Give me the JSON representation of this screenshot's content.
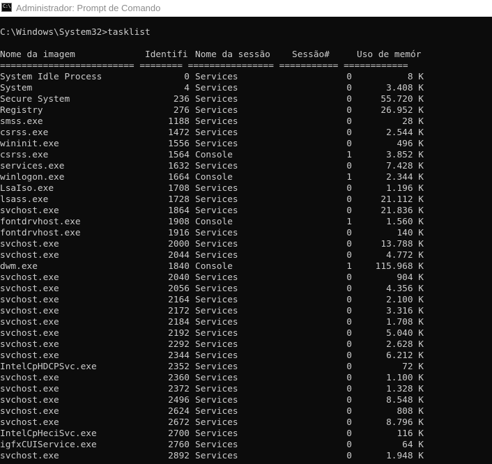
{
  "window": {
    "title": "Administrador: Prompt de Comando",
    "icon_glyph": "C:\\",
    "colors": {
      "console_bg": "#0c0c0c",
      "console_fg": "#cccccc",
      "titlebar_bg": "#ffffff",
      "title_fg": "#8c8c8c"
    }
  },
  "console": {
    "prompt_line": "C:\\Windows\\System32>tasklist",
    "headers": {
      "image": "Nome da imagem",
      "pid": "Identifi",
      "session_name": "Nome da sessão",
      "session_num": "Sessão#",
      "mem": "Uso de memór"
    },
    "separator": "========================= ======== ================ =========== ============",
    "rows": [
      {
        "image": "System Idle Process",
        "pid": "0",
        "session_name": "Services",
        "session_num": "0",
        "mem": "8 K"
      },
      {
        "image": "System",
        "pid": "4",
        "session_name": "Services",
        "session_num": "0",
        "mem": "3.408 K"
      },
      {
        "image": "Secure System",
        "pid": "236",
        "session_name": "Services",
        "session_num": "0",
        "mem": "55.720 K"
      },
      {
        "image": "Registry",
        "pid": "276",
        "session_name": "Services",
        "session_num": "0",
        "mem": "26.952 K"
      },
      {
        "image": "smss.exe",
        "pid": "1188",
        "session_name": "Services",
        "session_num": "0",
        "mem": "28 K"
      },
      {
        "image": "csrss.exe",
        "pid": "1472",
        "session_name": "Services",
        "session_num": "0",
        "mem": "2.544 K"
      },
      {
        "image": "wininit.exe",
        "pid": "1556",
        "session_name": "Services",
        "session_num": "0",
        "mem": "496 K"
      },
      {
        "image": "csrss.exe",
        "pid": "1564",
        "session_name": "Console",
        "session_num": "1",
        "mem": "3.852 K"
      },
      {
        "image": "services.exe",
        "pid": "1632",
        "session_name": "Services",
        "session_num": "0",
        "mem": "7.428 K"
      },
      {
        "image": "winlogon.exe",
        "pid": "1664",
        "session_name": "Console",
        "session_num": "1",
        "mem": "2.344 K"
      },
      {
        "image": "LsaIso.exe",
        "pid": "1708",
        "session_name": "Services",
        "session_num": "0",
        "mem": "1.196 K"
      },
      {
        "image": "lsass.exe",
        "pid": "1728",
        "session_name": "Services",
        "session_num": "0",
        "mem": "21.112 K"
      },
      {
        "image": "svchost.exe",
        "pid": "1864",
        "session_name": "Services",
        "session_num": "0",
        "mem": "21.836 K"
      },
      {
        "image": "fontdrvhost.exe",
        "pid": "1908",
        "session_name": "Console",
        "session_num": "1",
        "mem": "1.560 K"
      },
      {
        "image": "fontdrvhost.exe",
        "pid": "1916",
        "session_name": "Services",
        "session_num": "0",
        "mem": "140 K"
      },
      {
        "image": "svchost.exe",
        "pid": "2000",
        "session_name": "Services",
        "session_num": "0",
        "mem": "13.788 K"
      },
      {
        "image": "svchost.exe",
        "pid": "2044",
        "session_name": "Services",
        "session_num": "0",
        "mem": "4.772 K"
      },
      {
        "image": "dwm.exe",
        "pid": "1840",
        "session_name": "Console",
        "session_num": "1",
        "mem": "115.968 K"
      },
      {
        "image": "svchost.exe",
        "pid": "2040",
        "session_name": "Services",
        "session_num": "0",
        "mem": "904 K"
      },
      {
        "image": "svchost.exe",
        "pid": "2056",
        "session_name": "Services",
        "session_num": "0",
        "mem": "4.356 K"
      },
      {
        "image": "svchost.exe",
        "pid": "2164",
        "session_name": "Services",
        "session_num": "0",
        "mem": "2.100 K"
      },
      {
        "image": "svchost.exe",
        "pid": "2172",
        "session_name": "Services",
        "session_num": "0",
        "mem": "3.316 K"
      },
      {
        "image": "svchost.exe",
        "pid": "2184",
        "session_name": "Services",
        "session_num": "0",
        "mem": "1.708 K"
      },
      {
        "image": "svchost.exe",
        "pid": "2192",
        "session_name": "Services",
        "session_num": "0",
        "mem": "5.040 K"
      },
      {
        "image": "svchost.exe",
        "pid": "2292",
        "session_name": "Services",
        "session_num": "0",
        "mem": "2.628 K"
      },
      {
        "image": "svchost.exe",
        "pid": "2344",
        "session_name": "Services",
        "session_num": "0",
        "mem": "6.212 K"
      },
      {
        "image": "IntelCpHDCPSvc.exe",
        "pid": "2352",
        "session_name": "Services",
        "session_num": "0",
        "mem": "72 K"
      },
      {
        "image": "svchost.exe",
        "pid": "2360",
        "session_name": "Services",
        "session_num": "0",
        "mem": "1.100 K"
      },
      {
        "image": "svchost.exe",
        "pid": "2372",
        "session_name": "Services",
        "session_num": "0",
        "mem": "1.328 K"
      },
      {
        "image": "svchost.exe",
        "pid": "2496",
        "session_name": "Services",
        "session_num": "0",
        "mem": "8.548 K"
      },
      {
        "image": "svchost.exe",
        "pid": "2624",
        "session_name": "Services",
        "session_num": "0",
        "mem": "808 K"
      },
      {
        "image": "svchost.exe",
        "pid": "2672",
        "session_name": "Services",
        "session_num": "0",
        "mem": "8.796 K"
      },
      {
        "image": "IntelCpHeciSvc.exe",
        "pid": "2700",
        "session_name": "Services",
        "session_num": "0",
        "mem": "116 K"
      },
      {
        "image": "igfxCUIService.exe",
        "pid": "2760",
        "session_name": "Services",
        "session_num": "0",
        "mem": "64 K"
      },
      {
        "image": "svchost.exe",
        "pid": "2892",
        "session_name": "Services",
        "session_num": "0",
        "mem": "1.948 K"
      }
    ]
  }
}
